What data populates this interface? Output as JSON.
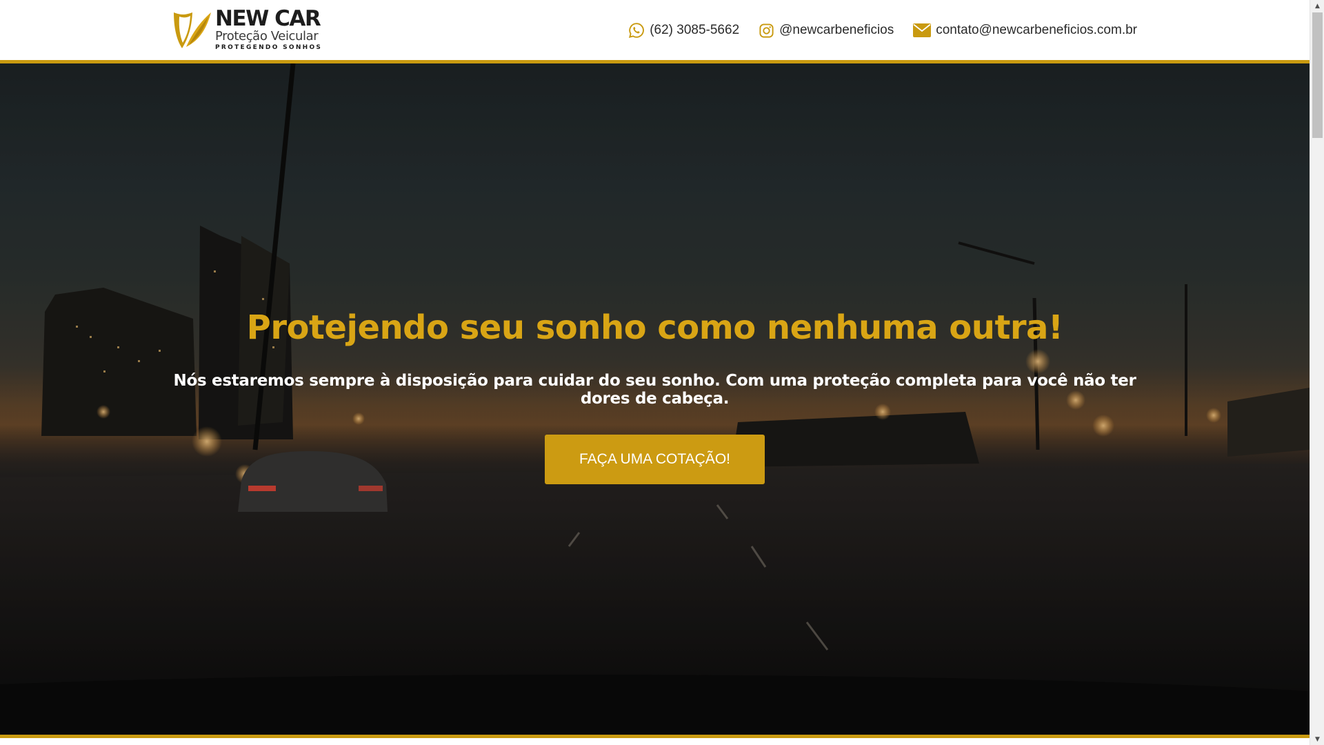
{
  "header": {
    "logo": {
      "name": "NEW CAR",
      "subtitle": "Proteção Veicular",
      "tagline": "PROTEGENDO SONHOS",
      "icon": "shield-leaf-logo"
    },
    "contacts": [
      {
        "icon": "whatsapp-icon",
        "text": "(62) 3085-5662"
      },
      {
        "icon": "instagram-icon",
        "text": "@newcarbeneficios"
      },
      {
        "icon": "envelope-icon",
        "text": "contato@newcarbeneficios.com.br"
      }
    ]
  },
  "hero": {
    "title": "Protejendo seu sonho como nenhuma outra!",
    "subtitle": "Nós estaremos sempre à disposição para cuidar do seu sonho. Com uma proteção completa para você não ter dores de cabeça.",
    "cta_label": "FAÇA UMA COTAÇÃO!",
    "background": "night highway city skyline photo"
  },
  "scrollbar": {
    "up_arrow": "▲",
    "down_arrow": "▼"
  },
  "colors": {
    "accent": "#cc9b12",
    "title_gold": "#d9a515",
    "header_bg": "#ffffff",
    "text_dark": "#2b2b2b"
  }
}
